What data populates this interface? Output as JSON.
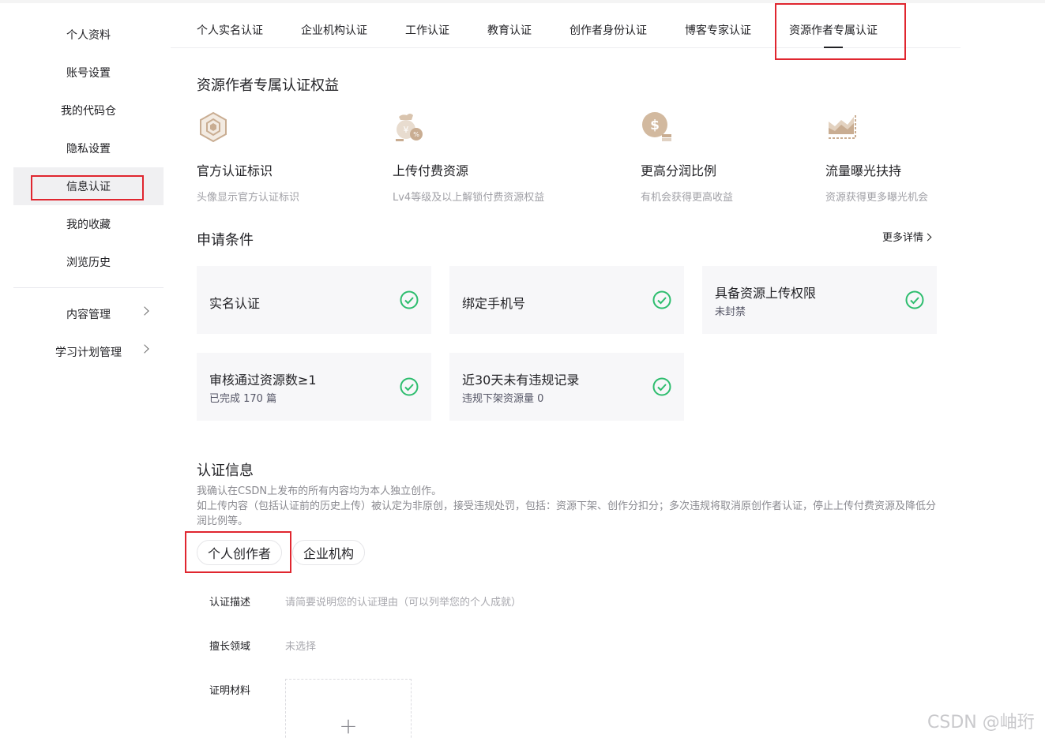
{
  "sidebar": {
    "items": [
      {
        "label": "个人资料"
      },
      {
        "label": "账号设置"
      },
      {
        "label": "我的代码仓"
      },
      {
        "label": "隐私设置"
      },
      {
        "label": "信息认证"
      },
      {
        "label": "我的收藏"
      },
      {
        "label": "浏览历史"
      }
    ],
    "groups": [
      {
        "label": "内容管理"
      },
      {
        "label": "学习计划管理"
      }
    ]
  },
  "tabs": [
    {
      "label": "个人实名认证"
    },
    {
      "label": "企业机构认证"
    },
    {
      "label": "工作认证"
    },
    {
      "label": "教育认证"
    },
    {
      "label": "创作者身份认证"
    },
    {
      "label": "博客专家认证"
    },
    {
      "label": "资源作者专属认证"
    }
  ],
  "benefits": {
    "heading": "资源作者专属认证权益",
    "items": [
      {
        "title": "官方认证标识",
        "desc": "头像显示官方认证标识",
        "icon": "official-badge-icon"
      },
      {
        "title": "上传付费资源",
        "desc": "Lv4等级及以上解锁付费资源权益",
        "icon": "paid-resource-icon"
      },
      {
        "title": "更高分润比例",
        "desc": "有机会获得更高收益",
        "icon": "revenue-share-icon"
      },
      {
        "title": "流量曝光扶持",
        "desc": "资源获得更多曝光机会",
        "icon": "traffic-boost-icon"
      }
    ]
  },
  "conditions": {
    "heading": "申请条件",
    "more": "更多详情",
    "items": [
      {
        "title": "实名认证",
        "sub": ""
      },
      {
        "title": "绑定手机号",
        "sub": ""
      },
      {
        "title": "具备资源上传权限",
        "sub": "未封禁"
      },
      {
        "title": "审核通过资源数≥1",
        "sub": "已完成 170 篇"
      },
      {
        "title": "近30天未有违规记录",
        "sub": "违规下架资源量 0"
      }
    ],
    "check_color": "#2dbd6e"
  },
  "auth": {
    "heading": "认证信息",
    "note_line1": "我确认在CSDN上发布的所有内容均为本人独立创作。",
    "note_line2": "如上传内容（包括认证前的历史上传）被认定为非原创，接受违规处罚，包括：资源下架、创作分扣分；多次违规将取消原创作者认证，停止上传付费资源及降低分润比例等。",
    "type_personal": "个人创作者",
    "type_org": "企业机构",
    "desc_label": "认证描述",
    "desc_placeholder": "请简要说明您的认证理由（可以列举您的个人成就）",
    "field_label": "擅长领域",
    "field_value": "未选择",
    "proof_label": "证明材料",
    "upload_symbol": "+"
  },
  "watermark": "CSDN @岫珩",
  "colors": {
    "highlight_box": "#e0262f",
    "icon_tan": "#c9ad92"
  }
}
